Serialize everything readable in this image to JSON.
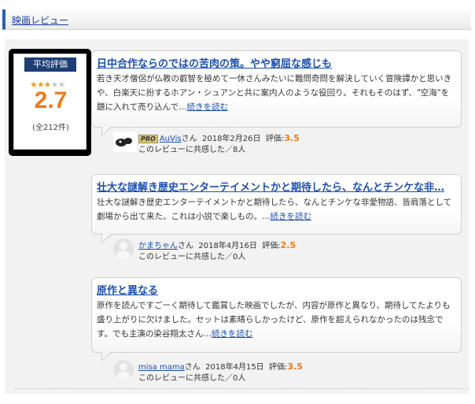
{
  "section": {
    "title": "映画レビュー"
  },
  "rating": {
    "label": "平均評価",
    "value": "2.7",
    "stars": 2.7,
    "max_stars": 5,
    "count": "(全212件)"
  },
  "reviews": [
    {
      "title": "日中合作ならのではの苦肉の策。やや窮屈な感じも",
      "body": "若き天才僧侶が仏教の叡智を極めて一休さんみたいに難問奇問を解決していく冒険譚かと思いきや、白楽天に扮するホアン・シュアンと共に案内人のような役回り。それもそのはず、\"空海\"を題に入れて売り込んで…",
      "read_more": "続きを読む",
      "pro": "PRO",
      "user": "AuVis",
      "user_suffix": "さん",
      "date": "2018年2月26日",
      "score_label": "評価:",
      "score": "3.5",
      "empathy": "このレビューに共感した／8人"
    },
    {
      "title": "壮大な謎解き歴史エンターテイメントかと期待したら、なんとチンケな非…",
      "body": "壮大な謎解き歴史エンターテイメントかと期待したら、なんとチンケな非愛物語、皆肩落として劇場から出て来た。これは小説で楽しもの。…",
      "read_more": "続きを読む",
      "user": "かまちゃん",
      "user_suffix": "さん",
      "date": "2018年4月16日",
      "score_label": "評価:",
      "score": "2.5",
      "empathy": "このレビューに共感した／0人"
    },
    {
      "title": "原作と異なる",
      "body": "原作を読んですごーく期待して鑑賞した映画でしたが、内容が原作と異なり、期待してたよりも盛り上がりに欠けました。セットは素晴らしかったけど、原作を超えられなかったのは残念です。でも主演の染谷翔太さん…",
      "read_more": "続きを読む",
      "user": "misa mama",
      "user_suffix": "さん",
      "date": "2018年4月15日",
      "score_label": "評価:",
      "score": "3.5",
      "empathy": "このレビューに共感した／0人"
    }
  ]
}
